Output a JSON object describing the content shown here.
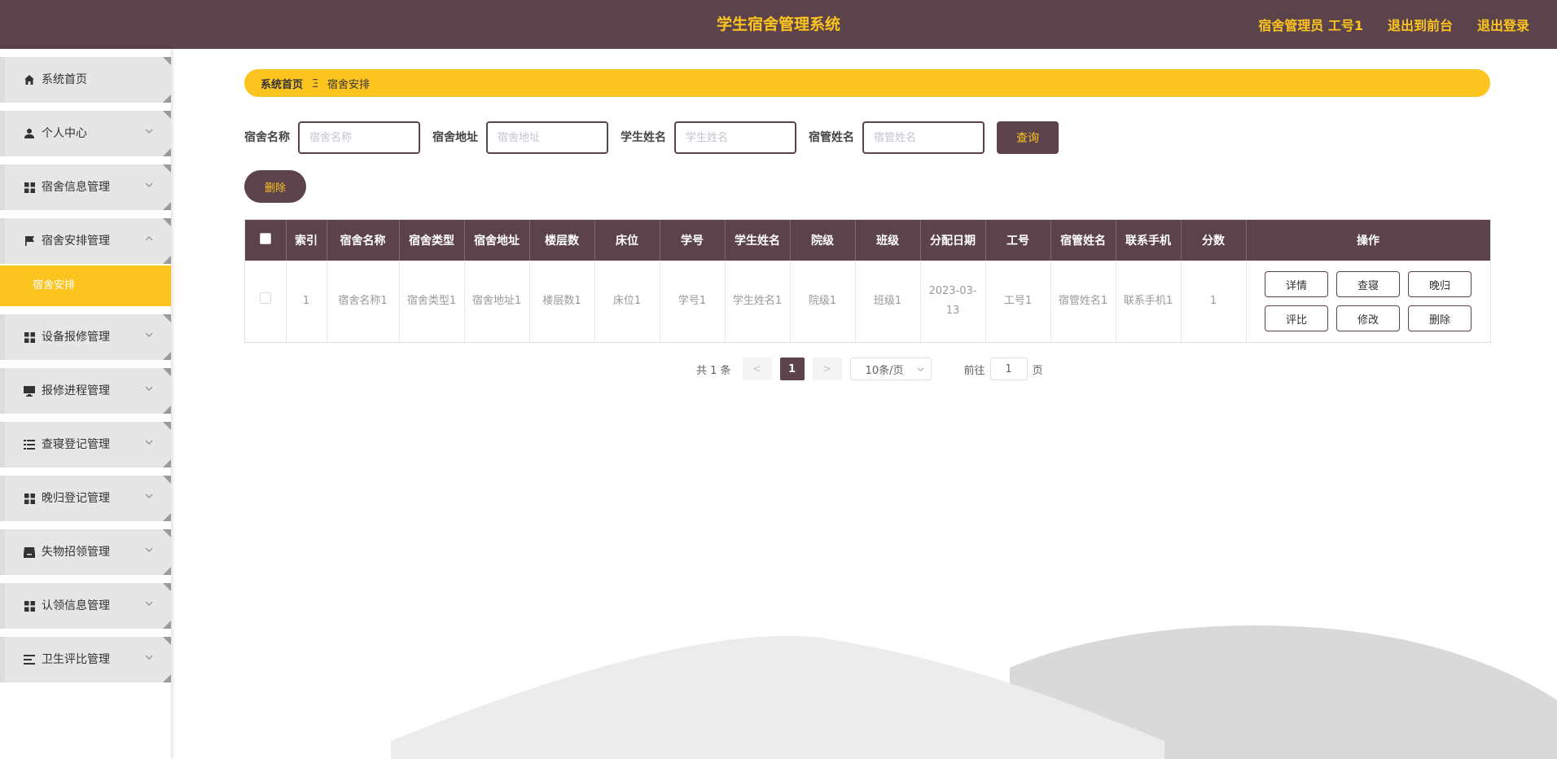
{
  "header": {
    "title": "学生宿舍管理系统",
    "user_label": "宿舍管理员 工号1",
    "back_to_front": "退出到前台",
    "logout": "退出登录"
  },
  "sidebar": {
    "items": [
      {
        "label": "系统首页",
        "icon": "home-icon"
      },
      {
        "label": "个人中心",
        "icon": "user-icon"
      },
      {
        "label": "宿舍信息管理",
        "icon": "grid-icon"
      },
      {
        "label": "宿舍安排管理",
        "icon": "flag-icon",
        "expanded": true
      },
      {
        "label": "设备报修管理",
        "icon": "grid-icon"
      },
      {
        "label": "报修进程管理",
        "icon": "monitor-icon"
      },
      {
        "label": "查寝登记管理",
        "icon": "list-icon"
      },
      {
        "label": "晚归登记管理",
        "icon": "grid-icon"
      },
      {
        "label": "失物招领管理",
        "icon": "inbox-icon"
      },
      {
        "label": "认领信息管理",
        "icon": "grid-icon"
      },
      {
        "label": "卫生评比管理",
        "icon": "list-icon"
      }
    ],
    "active_sub": "宿舍安排"
  },
  "breadcrumb": {
    "home": "系统首页",
    "current": "宿舍安排"
  },
  "search": {
    "fields": [
      {
        "label": "宿舍名称",
        "placeholder": "宿舍名称"
      },
      {
        "label": "宿舍地址",
        "placeholder": "宿舍地址"
      },
      {
        "label": "学生姓名",
        "placeholder": "学生姓名"
      },
      {
        "label": "宿管姓名",
        "placeholder": "宿管姓名"
      }
    ],
    "query_label": "查询"
  },
  "actions": {
    "delete_label": "删除"
  },
  "table": {
    "headers": [
      "索引",
      "宿舍名称",
      "宿舍类型",
      "宿舍地址",
      "楼层数",
      "床位",
      "学号",
      "学生姓名",
      "院级",
      "班级",
      "分配日期",
      "工号",
      "宿管姓名",
      "联系手机",
      "分数",
      "操作"
    ],
    "rows": [
      {
        "cells": [
          "1",
          "宿舍名称1",
          "宿舍类型1",
          "宿舍地址1",
          "楼层数1",
          "床位1",
          "学号1",
          "学生姓名1",
          "院级1",
          "班级1",
          "2023-03-13",
          "工号1",
          "宿管姓名1",
          "联系手机1",
          "1"
        ],
        "ops": [
          "详情",
          "查寝",
          "晚归",
          "评比",
          "修改",
          "删除"
        ]
      }
    ]
  },
  "pagination": {
    "total": "共 1 条",
    "prev": "<",
    "page": "1",
    "next": ">",
    "page_size": "10条/页",
    "goto_prefix": "前往",
    "goto_value": "1",
    "goto_suffix": "页"
  },
  "watermark": "CSDN @千里码科技",
  "colors": {
    "primary": "#5c434b",
    "accent": "#fcc41f"
  }
}
